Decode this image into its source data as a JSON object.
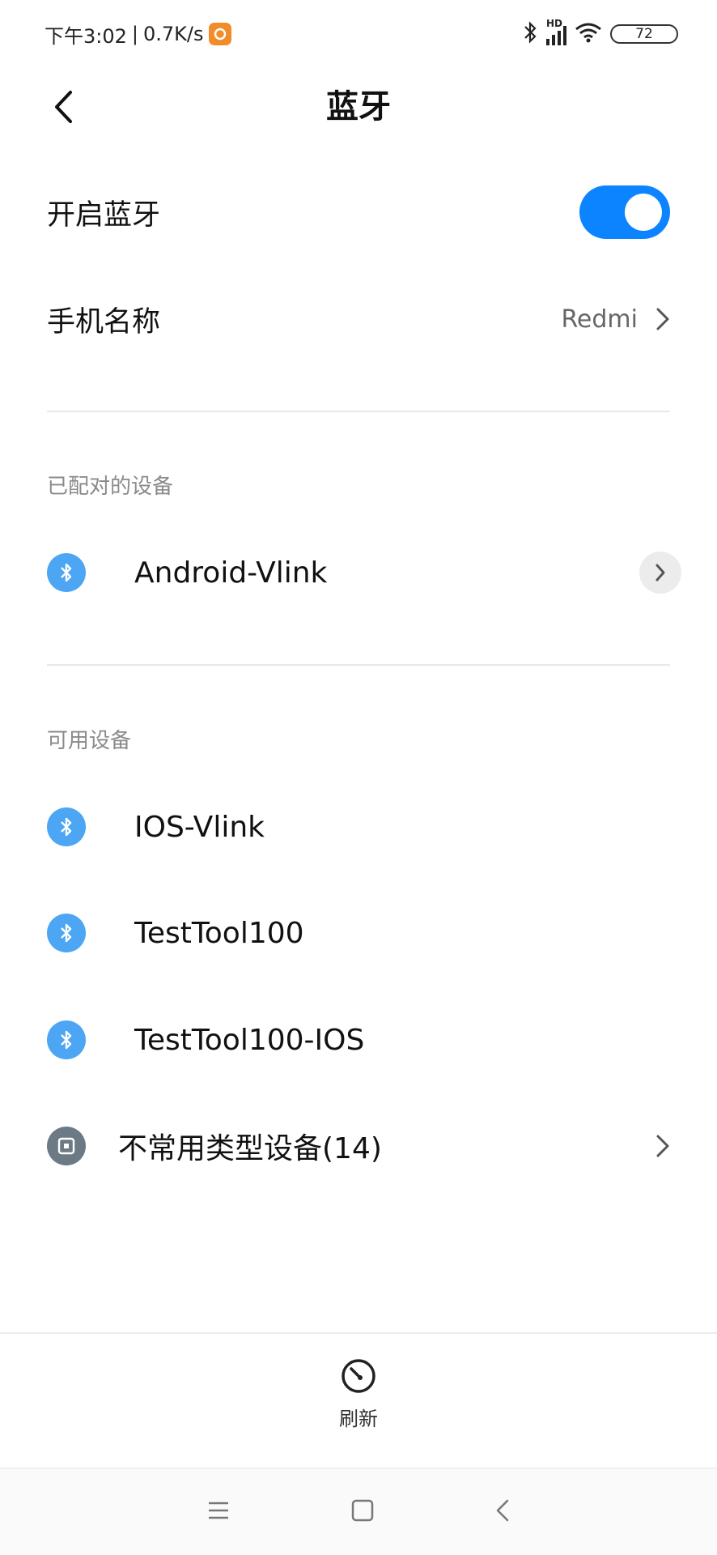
{
  "status_bar": {
    "time": "下午3:02",
    "separator": "|",
    "speed": "0.7K/s",
    "network_label": "HD",
    "battery": "72"
  },
  "header": {
    "title": "蓝牙"
  },
  "settings": {
    "bluetooth_toggle_label": "开启蓝牙",
    "bluetooth_enabled": true,
    "phone_name_label": "手机名称",
    "phone_name_value": "Redmi"
  },
  "paired": {
    "section_title": "已配对的设备",
    "devices": [
      {
        "name": "Android-Vlink"
      }
    ]
  },
  "available": {
    "section_title": "可用设备",
    "devices": [
      {
        "name": "IOS-Vlink"
      },
      {
        "name": "TestTool100"
      },
      {
        "name": "TestTool100-IOS"
      }
    ],
    "uncommon_label": "不常用类型设备(14)"
  },
  "actions": {
    "refresh_label": "刷新"
  },
  "colors": {
    "accent": "#0d84ff",
    "bt_icon_bg": "#4ca6f4",
    "section_title": "#8a8a8a"
  }
}
